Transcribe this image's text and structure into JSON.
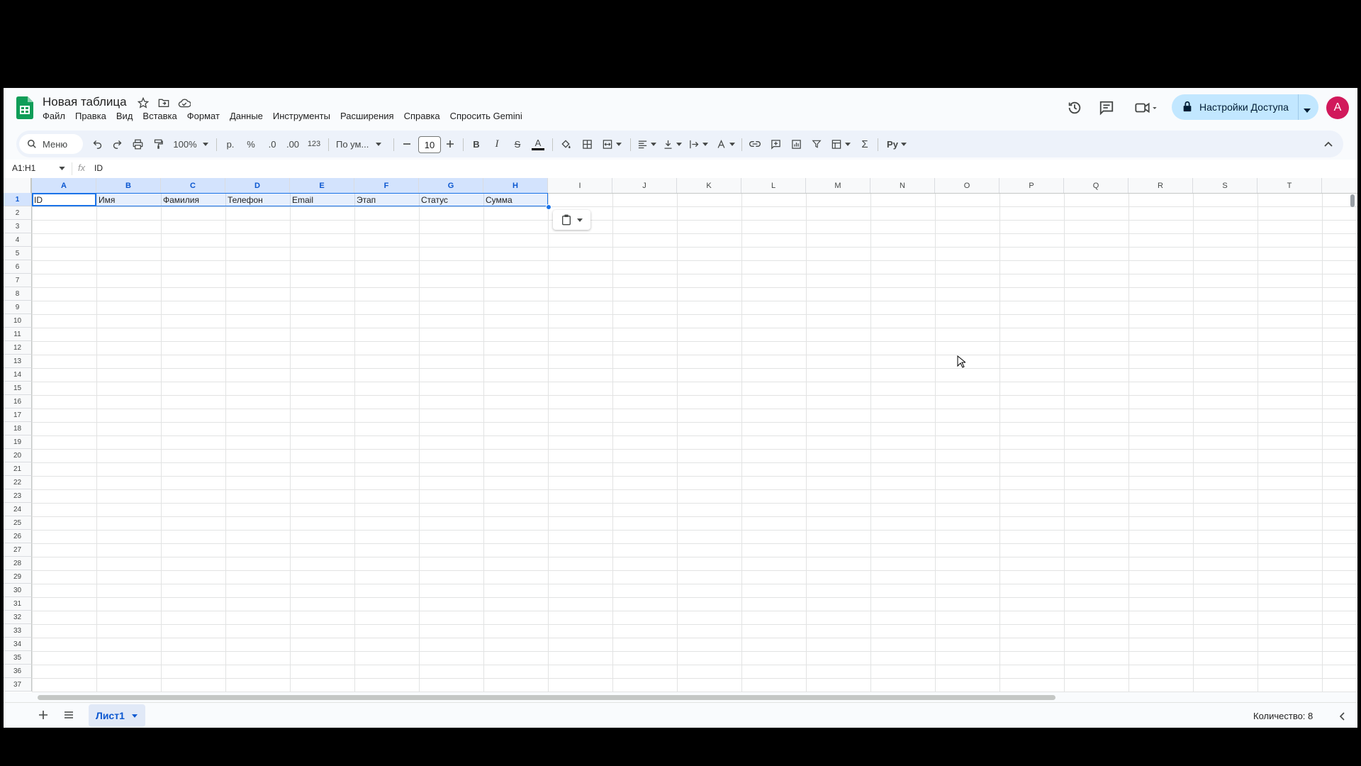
{
  "title": "Новая таблица",
  "menu": [
    "Файл",
    "Правка",
    "Вид",
    "Вставка",
    "Формат",
    "Данные",
    "Инструменты",
    "Расширения",
    "Справка",
    "Спросить Gemini"
  ],
  "share_label": "Настройки Доступа",
  "avatar_letter": "A",
  "toolbar": {
    "search_menu": "Меню",
    "zoom": "100%",
    "currency": "р.",
    "percent": "%",
    "decrease_decimal": ".0",
    "increase_decimal": ".00",
    "number_format": "123",
    "font": "По ум...",
    "font_size": "10",
    "bold": "B",
    "italic": "I",
    "strike": "S",
    "text_color": "A",
    "sigma": "Σ",
    "input_tools": "Py"
  },
  "name_box": "A1:H1",
  "fx": "fx",
  "formula_value": "ID",
  "columns": [
    "A",
    "B",
    "C",
    "D",
    "E",
    "F",
    "G",
    "H",
    "I",
    "J",
    "K",
    "L",
    "M",
    "N",
    "O",
    "P",
    "Q",
    "R",
    "S",
    "T"
  ],
  "row_count": 37,
  "header_row": [
    "ID",
    "Имя",
    "Фамилия",
    "Телефон",
    "Email",
    "Этап",
    "Статус",
    "Сумма"
  ],
  "sheet_name": "Лист1",
  "status": "Количество: 8",
  "colors": {
    "accent": "#1a73e8",
    "share_bg": "#c2e7ff",
    "avatar": "#d1195b",
    "sheets_green": "#0f9d58"
  }
}
